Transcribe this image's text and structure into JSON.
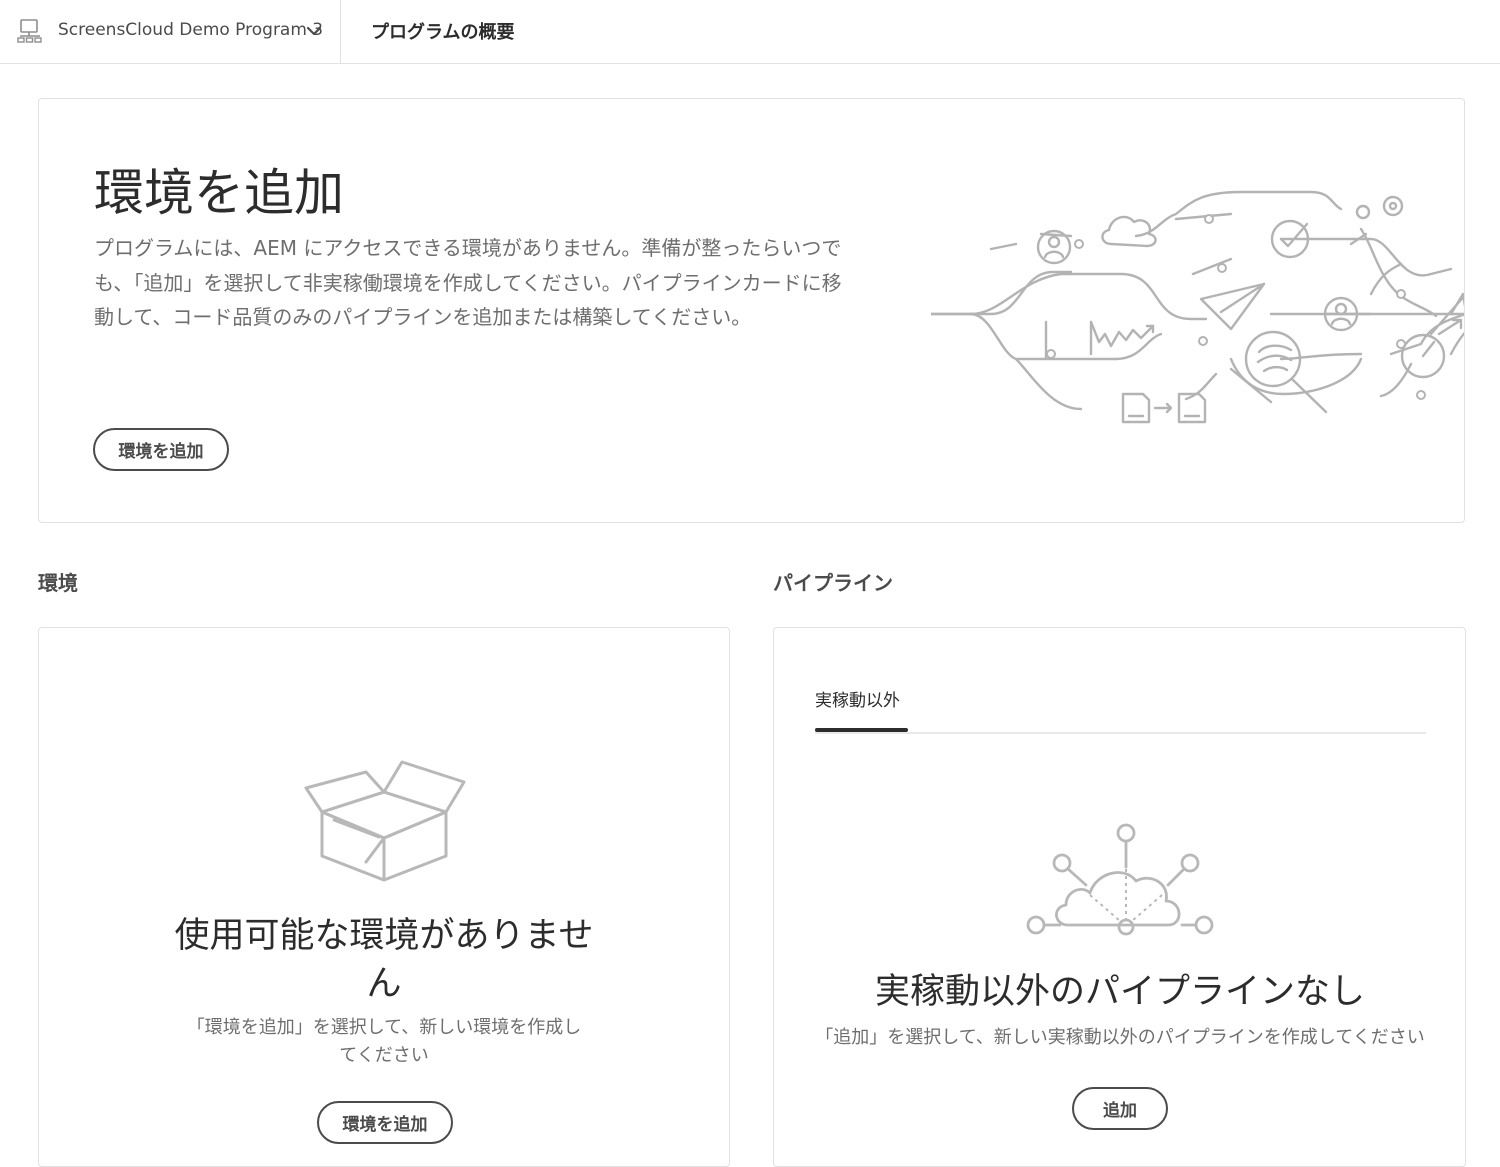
{
  "header": {
    "program_name": "ScreensCloud Demo Program 3",
    "program_icon": "program-icon",
    "dropdown_icon": "chevron-down-icon",
    "page_title": "プログラムの概要"
  },
  "hero": {
    "title": "環境を追加",
    "description": "プログラムには、AEM にアクセスできる環境がありません。準備が整ったらいつでも、「追加」を選択して非実稼働環境を作成してください。パイプラインカードに移動して、コード品質のみのパイプラインを追加または構築してください。",
    "button_label": "環境を追加",
    "illustration": "workflow-illustration"
  },
  "environments": {
    "heading": "環境",
    "empty_icon": "open-box-icon",
    "empty_title": "使用可能な環境がありません",
    "empty_description": "「環境を追加」を選択して、新しい環境を作成してください",
    "button_label": "環境を追加"
  },
  "pipelines": {
    "heading": "パイプライン",
    "tabs": [
      {
        "label": "実稼動以外",
        "selected": true
      }
    ],
    "empty_icon": "cloud-network-icon",
    "empty_title": "実稼動以外のパイプラインなし",
    "empty_description": "「追加」を選択して、新しい実稼動以外のパイプラインを作成してください",
    "button_label": "追加"
  },
  "colors": {
    "text": "#2c2c2c",
    "muted": "#6e6e6e",
    "border": "#e1e1e1",
    "illustration": "#b3b3b3"
  }
}
